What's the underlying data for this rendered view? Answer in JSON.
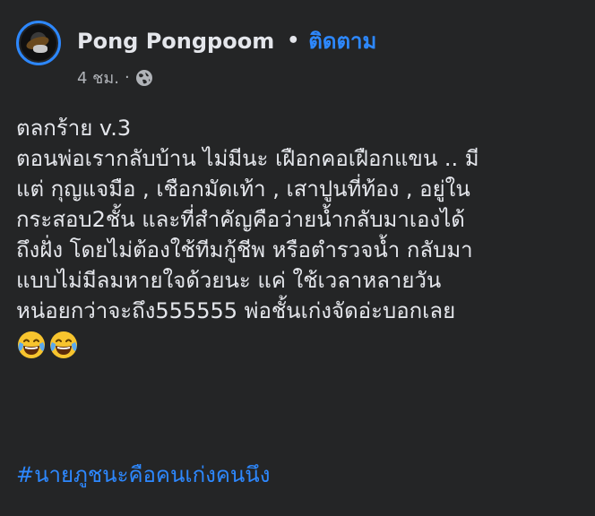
{
  "post": {
    "author": "Pong Pongpoom",
    "separator": "•",
    "follow_label": "ติดตาม",
    "timestamp": "4 ชม.",
    "meta_separator": "·",
    "privacy_icon": "globe-icon",
    "lines": [
      "ตลกร้าย v.3",
      "ตอนพ่อเรากลับบ้าน ไม่มีนะ เฝือกคอเฝือกแขน .. มี",
      "แต่ กุญแจมือ , เชือกมัดเท้า , เสาปูนที่ท้อง , อยู่ใน",
      "กระสอบ2ชั้น และที่สำคัญคือว่ายน้ำกลับมาเองได้",
      "ถึงฝั่ง โดยไม่ต้องใช้ทีมกู้ชีพ หรือตำรวจน้ำ กลับมา",
      "แบบไม่มีลมหายใจด้วยนะ แค่ ใช้เวลาหลายวัน",
      "หน่อยกว่าจะถึง555555 พ่อชั้นเก่งจัดอ่ะบอกเลย"
    ],
    "emojis": [
      "tears-of-joy-emoji",
      "tears-of-joy-emoji"
    ],
    "hashtag": "#นายภูชนะคือคนเก่งคนนึง"
  },
  "colors": {
    "background": "#242526",
    "text": "#e4e6eb",
    "secondary_text": "#b0b3b8",
    "link": "#2d88ff"
  }
}
